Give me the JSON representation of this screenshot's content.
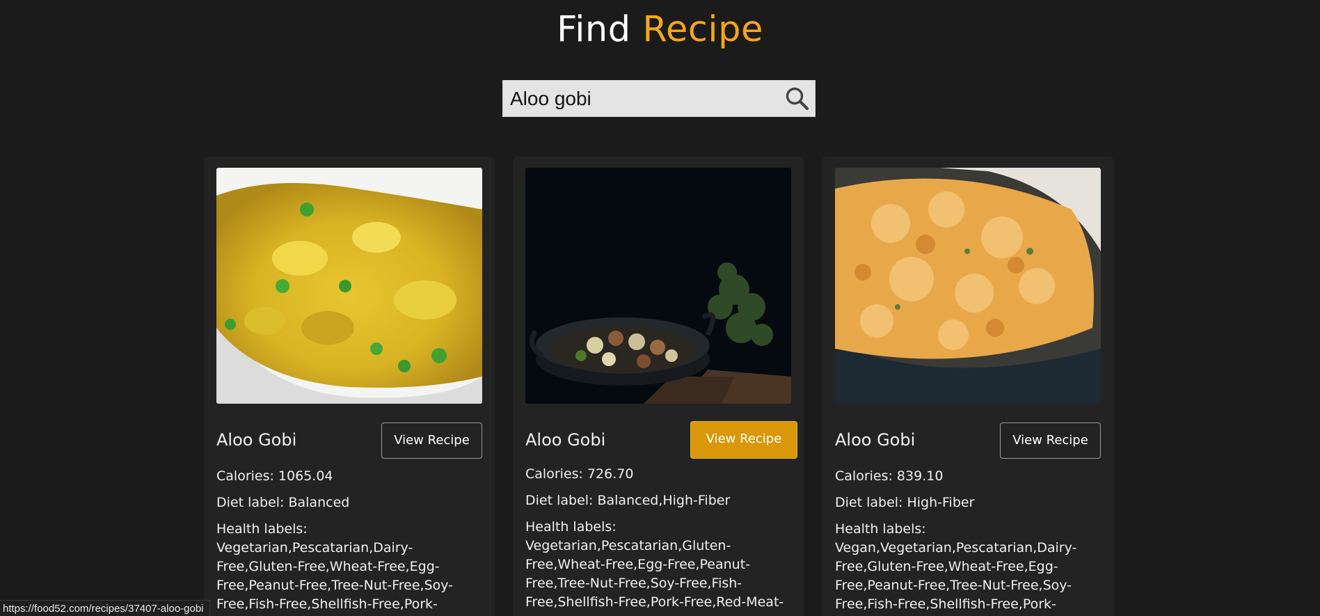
{
  "header": {
    "title_part1": "Find",
    "title_part2": "Recipe",
    "accent_color": "#f5a80d"
  },
  "search": {
    "value": "Aloo gobi",
    "icon": "search-icon"
  },
  "cards": [
    {
      "name": "Aloo Gobi",
      "button_label": "View Recipe",
      "calories": "Calories: 1065.04",
      "diet": "Diet label: Balanced",
      "health": "Health labels: Vegetarian,Pescatarian,Dairy-Free,Gluten-Free,Wheat-Free,Egg-Free,Peanut-Free,Tree-Nut-Free,Soy-Free,Fish-Free,Shellfish-Free,Pork-"
    },
    {
      "name": "Aloo Gobi",
      "button_label": "View Recipe",
      "calories": "Calories: 726.70",
      "diet": "Diet label: Balanced,High-Fiber",
      "health": "Health labels: Vegetarian,Pescatarian,Gluten-Free,Wheat-Free,Egg-Free,Peanut-Free,Tree-Nut-Free,Soy-Free,Fish-Free,Shellfish-Free,Pork-Free,Red-Meat-"
    },
    {
      "name": "Aloo Gobi",
      "button_label": "View Recipe",
      "calories": "Calories: 839.10",
      "diet": "Diet label: High-Fiber",
      "health": "Health labels: Vegan,Vegetarian,Pescatarian,Dairy-Free,Gluten-Free,Wheat-Free,Egg-Free,Peanut-Free,Tree-Nut-Free,Soy-Free,Fish-Free,Shellfish-Free,Pork-"
    }
  ],
  "status_url": "https://food52.com/recipes/37407-aloo-gobi"
}
